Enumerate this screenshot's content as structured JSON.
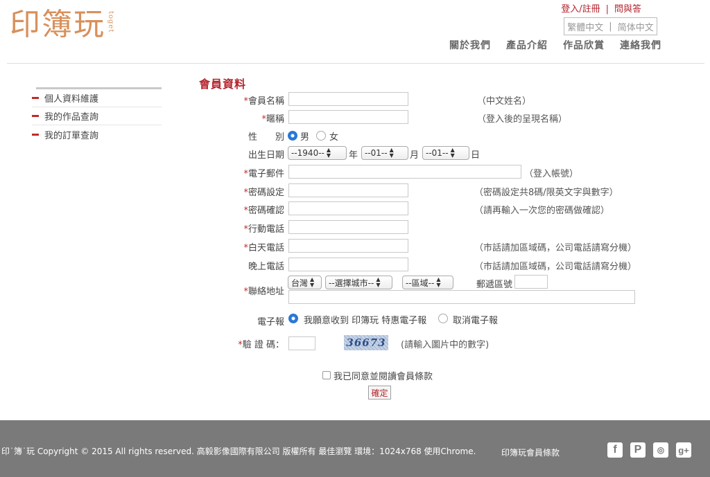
{
  "header": {
    "logo_main": "印簿玩",
    "logo_vertical": "toget",
    "login_register": "登入/註冊",
    "faq": "問與答",
    "lang_trad": "繁體中文",
    "lang_simp": "简体中文",
    "nav": [
      "關於我們",
      "產品介紹",
      "作品欣賞",
      "連絡我們"
    ]
  },
  "sidebar": {
    "items": [
      {
        "label": "個人資料維護"
      },
      {
        "label": "我的作品查詢"
      },
      {
        "label": "我的訂單查詢"
      }
    ]
  },
  "form": {
    "title": "會員資料",
    "member_name": {
      "label": "會員名稱",
      "hint": "（中文姓名）"
    },
    "nickname": {
      "label": "暱稱",
      "hint": "（登入後的呈現名稱）"
    },
    "gender": {
      "label": "性　　別",
      "male": "男",
      "female": "女",
      "selected": "男"
    },
    "birthday": {
      "label": "出生日期",
      "year": "--1940--",
      "year_unit": "年",
      "month": "--01--",
      "month_unit": "月",
      "day": "--01--",
      "day_unit": "日"
    },
    "email": {
      "label": "電子郵件",
      "hint": "（登入帳號）"
    },
    "password": {
      "label": "密碼設定",
      "hint": "（密碼設定共8碼/限英文字與數字）"
    },
    "password_confirm": {
      "label": "密碼確認",
      "hint": "（請再輸入一次您的密碼做確認）"
    },
    "mobile": {
      "label": "行動電話"
    },
    "day_phone": {
      "label": "白天電話",
      "hint": "（市話請加區域碼，公司電話請寫分機）"
    },
    "night_phone": {
      "label": "晚上電話",
      "hint": "（市話請加區域碼，公司電話請寫分機）"
    },
    "address": {
      "label": "聯絡地址",
      "country": "台灣",
      "city": "--選擇城市--",
      "district": "--區域--",
      "zip_label": "郵遞區號"
    },
    "newsletter": {
      "label": "電子報",
      "subscribe": "我願意收到 印簿玩 特惠電子報",
      "unsubscribe": "取消電子報",
      "selected": "subscribe"
    },
    "captcha": {
      "label": "驗 證 碼：",
      "image_text": "36673",
      "hint": "(請輸入圖片中的數字)"
    },
    "agree": "我已同意並閱讀會員條款",
    "submit": "確定"
  },
  "footer": {
    "copyright": "印˙簿˙玩 Copyright © 2015 All rights reserved. 高毅影像國際有限公司 版權所有  最佳瀏覽 環境：1024x768 使用Chrome.",
    "terms": "印簿玩會員條款",
    "social_icons": [
      "facebook-icon",
      "pinterest-icon",
      "weibo-icon",
      "google-plus-icon"
    ]
  },
  "colors": {
    "accent": "#b3242d",
    "logo": "#d8905b",
    "footer_bg": "#7a7a7a"
  }
}
